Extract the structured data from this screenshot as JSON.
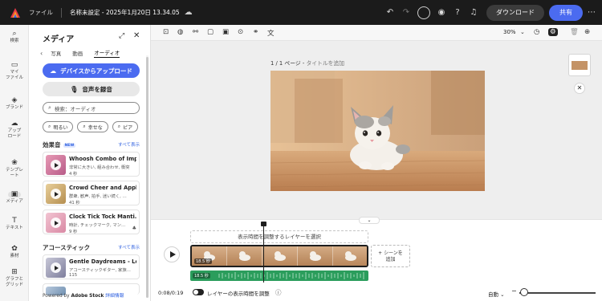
{
  "topbar": {
    "file_menu": "ファイル",
    "doc_title": "名称未設定 - 2025年1月20日 13.34.05",
    "download_label": "ダウンロード",
    "share_label": "共有"
  },
  "rail": {
    "items": [
      {
        "label": "検索",
        "icon": "search-icon"
      },
      {
        "label": "マイ\nファイル",
        "icon": "folder-icon"
      },
      {
        "label": "ブランド",
        "icon": "brand-icon"
      },
      {
        "label": "アップ\nロード",
        "icon": "upload-icon"
      },
      {
        "label": "テンプレ\nート",
        "icon": "template-icon"
      },
      {
        "label": "メディア",
        "icon": "media-icon"
      },
      {
        "label": "テキスト",
        "icon": "text-icon"
      },
      {
        "label": "素材",
        "icon": "elements-icon"
      },
      {
        "label": "グラフと\nグリッド",
        "icon": "grid-icon"
      }
    ]
  },
  "panel": {
    "title": "メディア",
    "tabs": [
      "写真",
      "動画",
      "オーディオ"
    ],
    "active_tab": "オーディオ",
    "upload_label": "デバイスからアップロード",
    "record_label": "音声を録音",
    "search_placeholder": "検索：オーディオ",
    "chips": [
      "明るい",
      "幸せな",
      "ピア"
    ],
    "sfx_section": {
      "title": "効果音",
      "badge": "NEW",
      "see_all": "すべて表示"
    },
    "sfx_items": [
      {
        "title": "Whoosh Combo of Imp…",
        "tags": "非常に大きい, 組み合わせ, 衝突",
        "duration": "4 秒"
      },
      {
        "title": "Crowd Cheer and Appl…",
        "tags": "群衆, 歓声, 拍手, 迷い続く, …",
        "duration": "41 秒"
      },
      {
        "title": "Clock Tick Tock Manti…",
        "tags": "時計, チェックマーク, マン…",
        "duration": "9 秒"
      }
    ],
    "acoustic_section": {
      "title": "アコースティック",
      "see_all": "すべて表示"
    },
    "acoustic_items": [
      {
        "title": "Gentle Daydreams - Lo…",
        "tags": "アコースティックギター, 家族…",
        "duration": "115"
      }
    ],
    "powered_prefix": "Powered by",
    "powered_brand": "Adobe Stock",
    "powered_link": "詳細情報"
  },
  "canvas_toolbar": {
    "zoom": "30%"
  },
  "canvas": {
    "page_label": "1 / 1 ページ",
    "title_placeholder": "タイトルを追加"
  },
  "timeline": {
    "layer_hint": "表示時間を調整するレイヤーを選択",
    "clip_duration": "18.5 秒",
    "add_scene": "+ シーンを\n追加",
    "audio_duration": "18.5 秒",
    "time_readout": "0:08/0:19",
    "toggle_label": "レイヤーの表示時間を調整",
    "auto_label": "自動"
  },
  "colors": {
    "accent": "#4b6bf0",
    "topbar_bg": "#1b1b1b",
    "audio_track": "#2b9d5c"
  }
}
